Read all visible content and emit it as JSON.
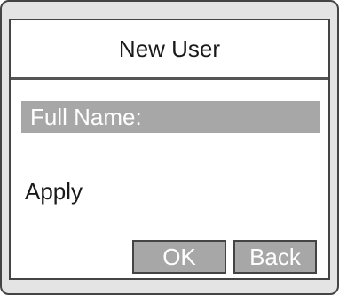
{
  "dialog": {
    "title": "New User",
    "selected_field_label": "Full Name:",
    "menu_item": "Apply"
  },
  "buttons": {
    "ok_label": "OK",
    "back_label": "Back"
  },
  "colors": {
    "highlight": "#a7a7a7",
    "frame": "#444444",
    "bezel": "#e4e4e4"
  }
}
